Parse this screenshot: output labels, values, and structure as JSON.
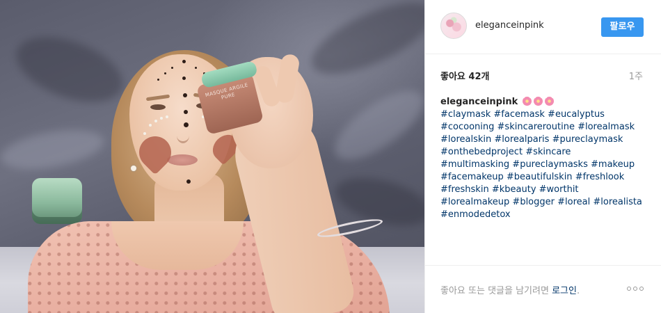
{
  "post": {
    "image_alt": "",
    "jar_label": "MASQUE ARGILE PURE"
  },
  "header": {
    "username": "eleganceinpink",
    "follow_label": "팔로우"
  },
  "stats": {
    "likes": "좋아요 42개",
    "time_ago": "1주"
  },
  "caption": {
    "author": "eleganceinpink",
    "emoji": [
      "cherry-blossom",
      "cherry-blossom",
      "cherry-blossom"
    ],
    "hashtags": [
      "#claymask",
      "#facemask",
      "#eucalyptus",
      "#cocooning",
      "#skincareroutine",
      "#lorealmask",
      "#lorealskin",
      "#lorealparis",
      "#pureclaymask",
      "#onthebedproject",
      "#skincare",
      "#multimasking",
      "#pureclaymasks",
      "#makeup",
      "#facemakeup",
      "#beautifulskin",
      "#freshlook",
      "#freshskin",
      "#kbeauty",
      "#worthit",
      "#lorealmakeup",
      "#blogger",
      "#loreal",
      "#lorealista",
      "#enmodedetox"
    ]
  },
  "footer": {
    "prompt_prefix": "좋아요 또는 댓글을 남기려면 ",
    "login_label": "로그인",
    "prompt_suffix": "."
  },
  "colors": {
    "accent": "#3897f0",
    "link": "#003569",
    "muted": "#999999"
  }
}
